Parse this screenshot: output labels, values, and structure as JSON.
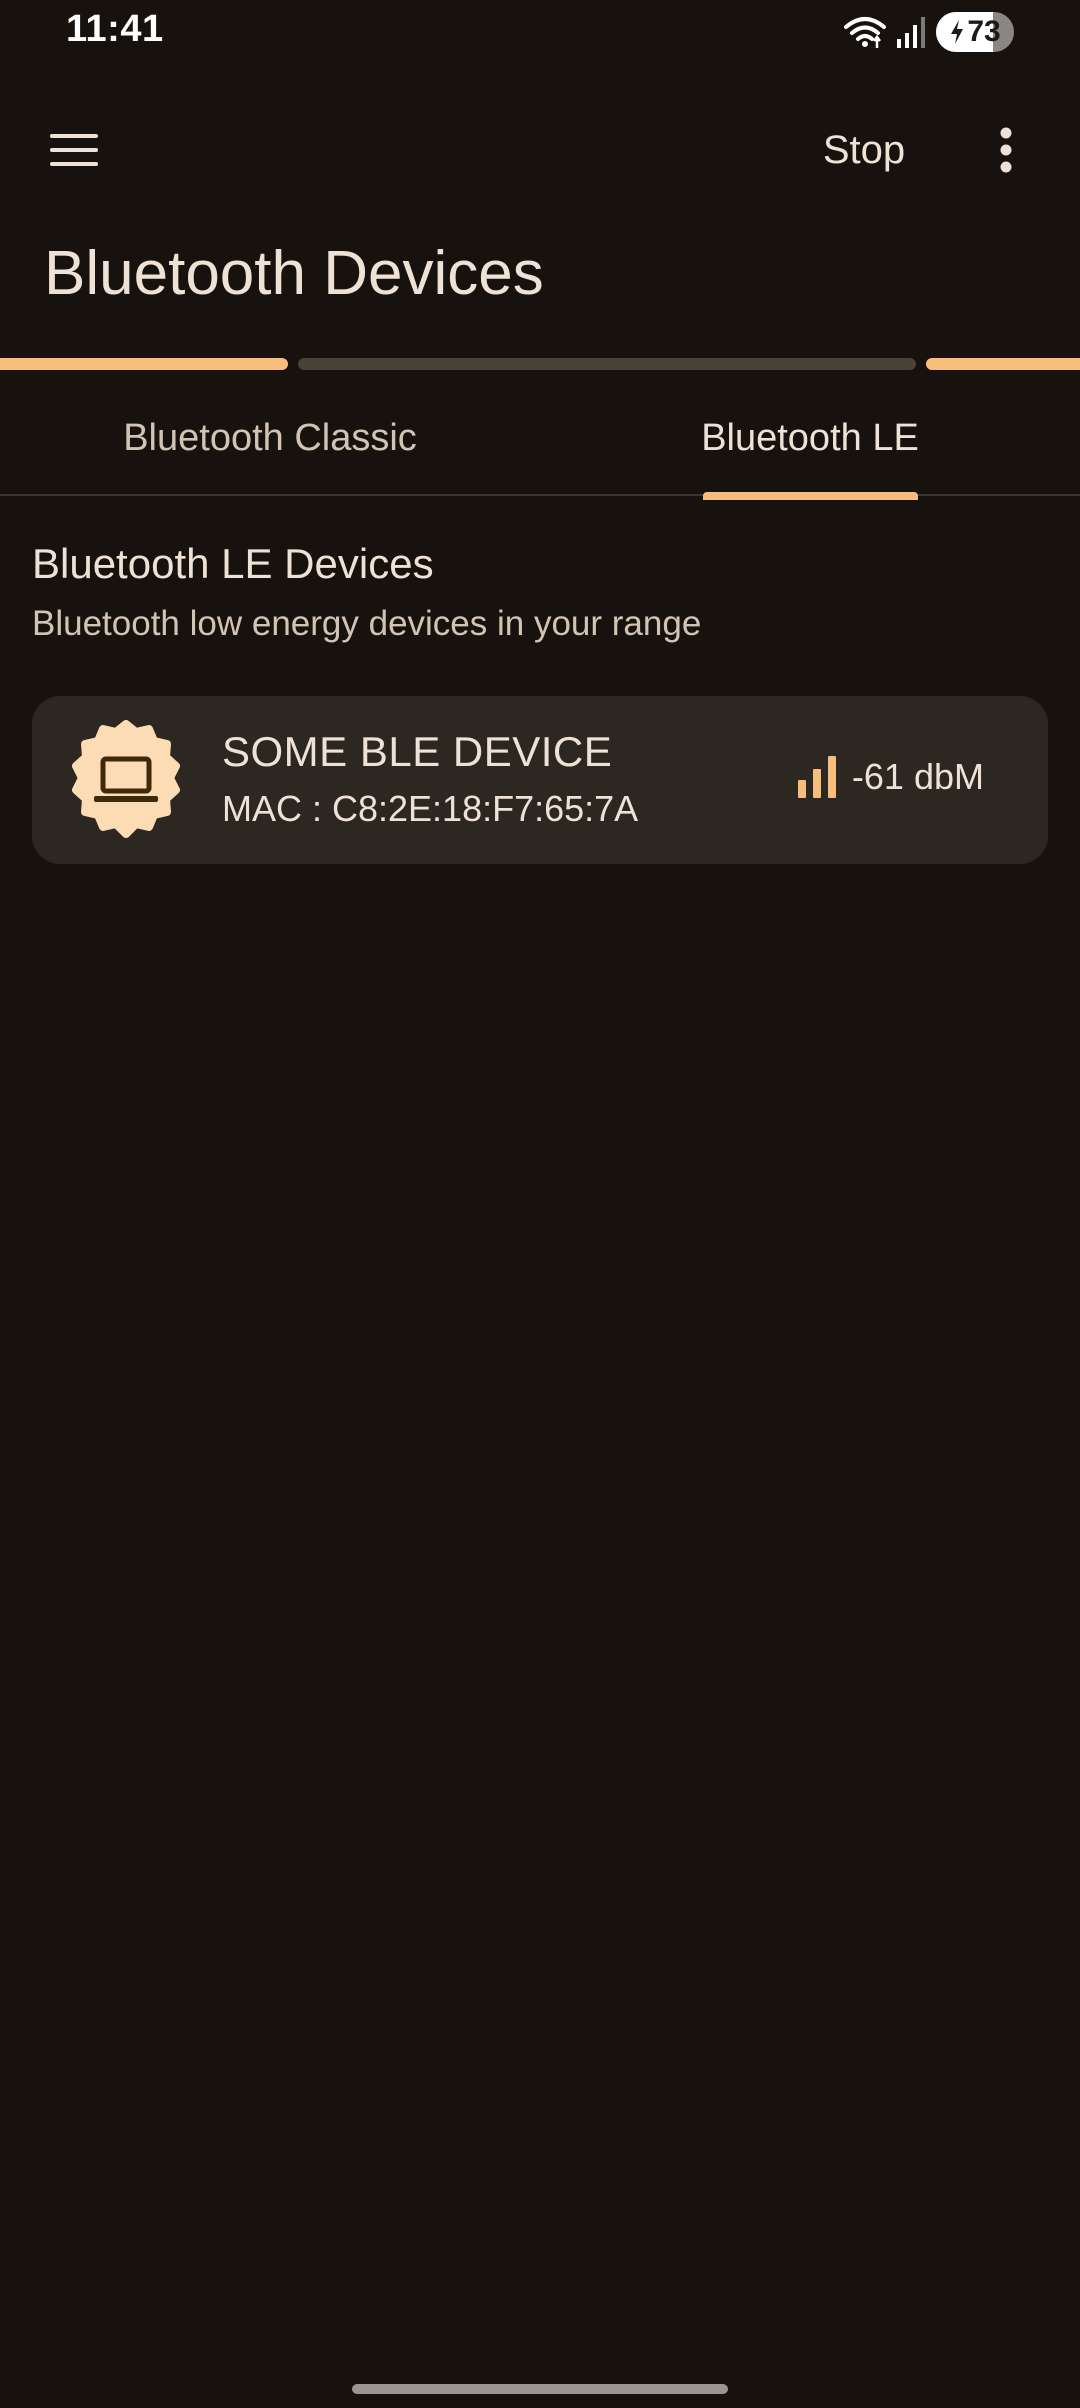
{
  "status_bar": {
    "time": "11:41",
    "battery_level": "73",
    "battery_fraction": 0.73,
    "icons": [
      "wifi-icon",
      "cellular-signal-icon",
      "battery-charging-icon"
    ]
  },
  "app_bar": {
    "menu_icon": "hamburger-menu-icon",
    "stop_label": "Stop",
    "overflow_icon": "more-vert-icon"
  },
  "page": {
    "title": "Bluetooth Devices"
  },
  "tabs": [
    {
      "label": "Bluetooth Classic",
      "selected": false
    },
    {
      "label": "Bluetooth LE",
      "selected": true
    }
  ],
  "section": {
    "title": "Bluetooth LE Devices",
    "subtitle": "Bluetooth low energy devices in your range"
  },
  "devices": [
    {
      "name": "SOME BLE DEVICE",
      "mac": "MAC : C8:2E:18:F7:65:7A",
      "rssi": "-61 dbM",
      "icon": "laptop-icon",
      "signal_icon": "signal-bars-icon"
    }
  ],
  "colors": {
    "background": "#17120e",
    "accent": "#f6be7a",
    "card": "#2d2722",
    "text_primary": "#eee2d6",
    "text_secondary": "#d2c4b4"
  }
}
